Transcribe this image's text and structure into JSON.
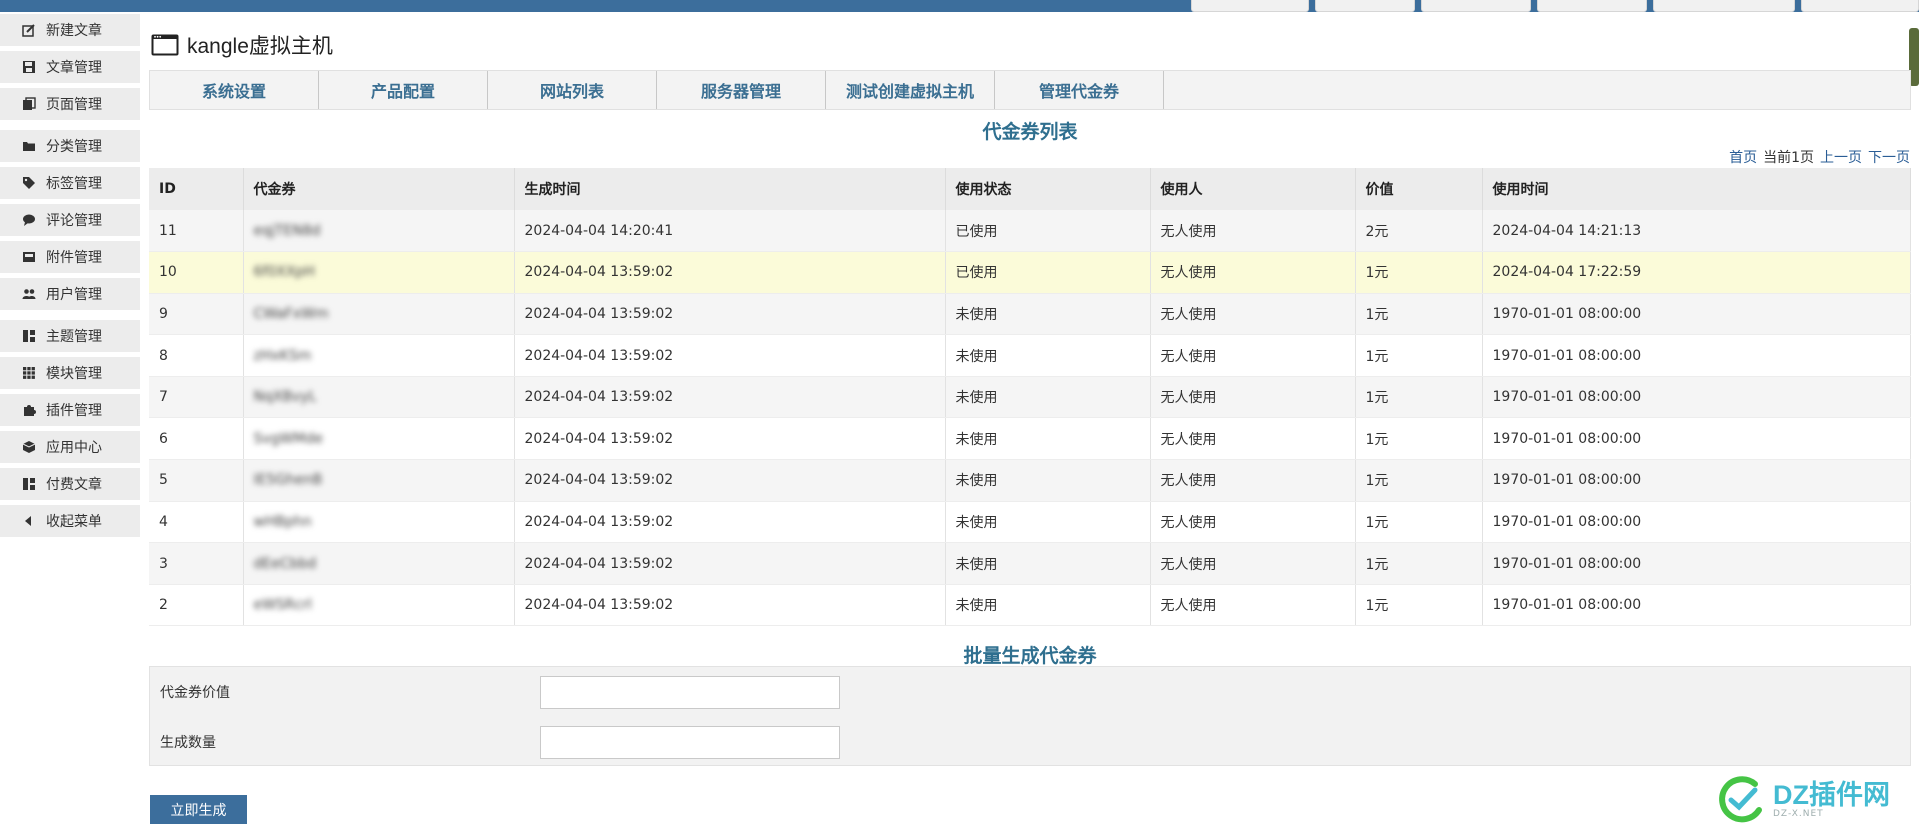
{
  "top_tabs": [
    "",
    "",
    "",
    "",
    "",
    ""
  ],
  "sidebar": {
    "items": [
      {
        "label": "新建文章",
        "icon": "edit-icon"
      },
      {
        "label": "文章管理",
        "icon": "save-icon"
      },
      {
        "label": "页面管理",
        "icon": "pages-icon"
      },
      {
        "label": "分类管理",
        "icon": "folder-icon"
      },
      {
        "label": "标签管理",
        "icon": "tag-icon"
      },
      {
        "label": "评论管理",
        "icon": "comment-icon"
      },
      {
        "label": "附件管理",
        "icon": "inbox-icon"
      },
      {
        "label": "用户管理",
        "icon": "users-icon"
      },
      {
        "label": "主题管理",
        "icon": "layout-icon"
      },
      {
        "label": "模块管理",
        "icon": "grid-icon"
      },
      {
        "label": "插件管理",
        "icon": "puzzle-icon"
      },
      {
        "label": "应用中心",
        "icon": "box-icon"
      },
      {
        "label": "付费文章",
        "icon": "layout-icon"
      },
      {
        "label": "收起菜单",
        "icon": "caret-left-icon"
      }
    ]
  },
  "header": {
    "title": "kangle虚拟主机",
    "icon": "window-icon"
  },
  "tabs": [
    "系统设置",
    "产品配置",
    "网站列表",
    "服务器管理",
    "测试创建虚拟主机",
    "管理代金券"
  ],
  "list_title": "代金券列表",
  "pager": {
    "first": "首页",
    "current": "当前1页",
    "prev": "上一页",
    "next": "下一页"
  },
  "table": {
    "columns": [
      "ID",
      "代金券",
      "生成时间",
      "使用状态",
      "使用人",
      "价值",
      "使用时间"
    ],
    "rows": [
      [
        "11",
        "eqjTEN8d",
        "2024-04-04 14:20:41",
        "已使用",
        "无人使用",
        "2元",
        "2024-04-04 14:21:13"
      ],
      [
        "10",
        "6f0XXpH",
        "2024-04-04 13:59:02",
        "已使用",
        "无人使用",
        "1元",
        "2024-04-04 17:22:59"
      ],
      [
        "9",
        "CWaFxWm",
        "2024-04-04 13:59:02",
        "未使用",
        "无人使用",
        "1元",
        "1970-01-01 08:00:00"
      ],
      [
        "8",
        "zHxKSm",
        "2024-04-04 13:59:02",
        "未使用",
        "无人使用",
        "1元",
        "1970-01-01 08:00:00"
      ],
      [
        "7",
        "NqXBvyL",
        "2024-04-04 13:59:02",
        "未使用",
        "无人使用",
        "1元",
        "1970-01-01 08:00:00"
      ],
      [
        "6",
        "SvgWMde",
        "2024-04-04 13:59:02",
        "未使用",
        "无人使用",
        "1元",
        "1970-01-01 08:00:00"
      ],
      [
        "5",
        "IE5GhenB",
        "2024-04-04 13:59:02",
        "未使用",
        "无人使用",
        "1元",
        "1970-01-01 08:00:00"
      ],
      [
        "4",
        "wHBphn",
        "2024-04-04 13:59:02",
        "未使用",
        "无人使用",
        "1元",
        "1970-01-01 08:00:00"
      ],
      [
        "3",
        "dEeCbbd",
        "2024-04-04 13:59:02",
        "未使用",
        "无人使用",
        "1元",
        "1970-01-01 08:00:00"
      ],
      [
        "2",
        "eWSRcrl",
        "2024-04-04 13:59:02",
        "未使用",
        "无人使用",
        "1元",
        "1970-01-01 08:00:00"
      ]
    ]
  },
  "batch_title": "批量生成代金券",
  "form": {
    "value_label": "代金券价值",
    "value_input": "",
    "count_label": "生成数量",
    "count_input": "",
    "submit_label": "立即生成"
  },
  "watermark": {
    "main": "DZ插件网",
    "sub": "DZ-X.NET"
  },
  "colors": {
    "accent": "#3c6e9c",
    "tab_text": "#3b6f92",
    "title_text": "#2f6f8f",
    "highlight_row": "#fbfbd9"
  }
}
